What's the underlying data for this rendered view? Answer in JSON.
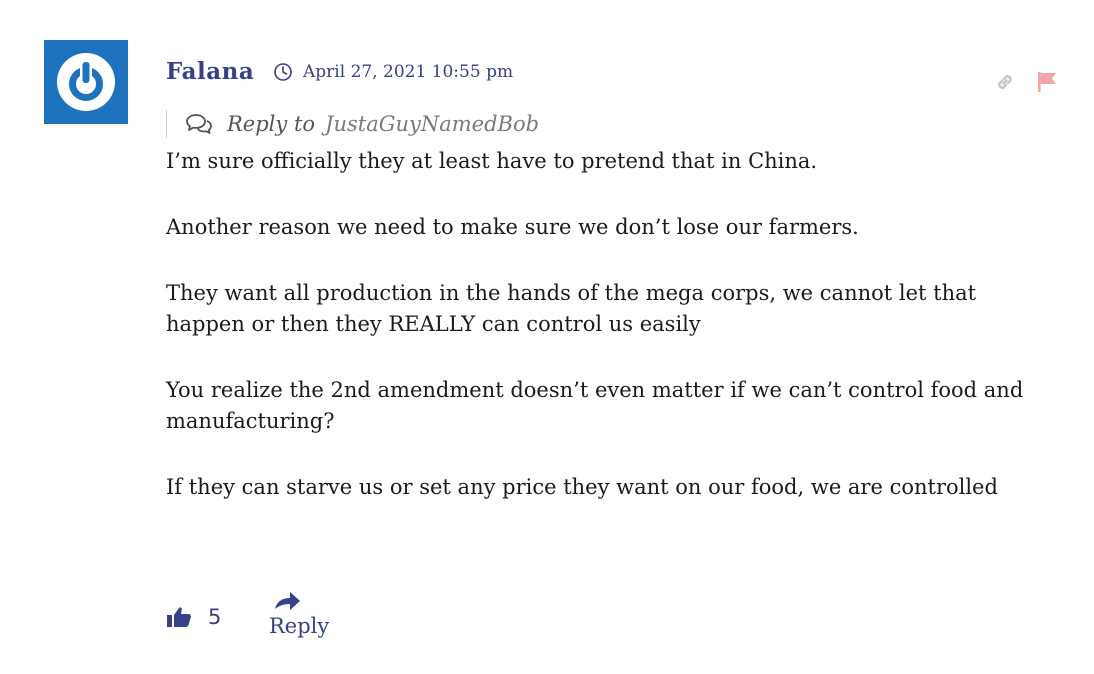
{
  "comment": {
    "author": "Falana",
    "date": "April 27, 2021 10:55 pm",
    "reply_to": {
      "label": "Reply to",
      "name": "JustaGuyNamedBob"
    },
    "paragraphs": [
      "I’m sure officially they at least have to pretend that in China.",
      "Another reason we need to make sure we don’t lose our farmers.",
      "They want all production in the hands of the mega corps, we cannot let that happen or then they REALLY can control us easily",
      "You realize the 2nd amendment doesn’t even matter if we can’t control food and manufacturing?",
      "If they can starve us or set any price they want on our food, we are controlled"
    ],
    "votes": "5",
    "reply_label": "Reply"
  },
  "icons": {
    "avatar": "power-icon",
    "date": "clock-icon",
    "reply_to": "chat-bubbles-icon",
    "permalink": "link-icon",
    "report": "flag-icon",
    "vote": "thumbs-up-icon",
    "reply": "reply-arrow-icon"
  },
  "colors": {
    "accent": "#37408a",
    "avatar_bg": "#1e73be",
    "link_icon": "#c8c8c8",
    "flag_icon": "#f4a6a6"
  }
}
